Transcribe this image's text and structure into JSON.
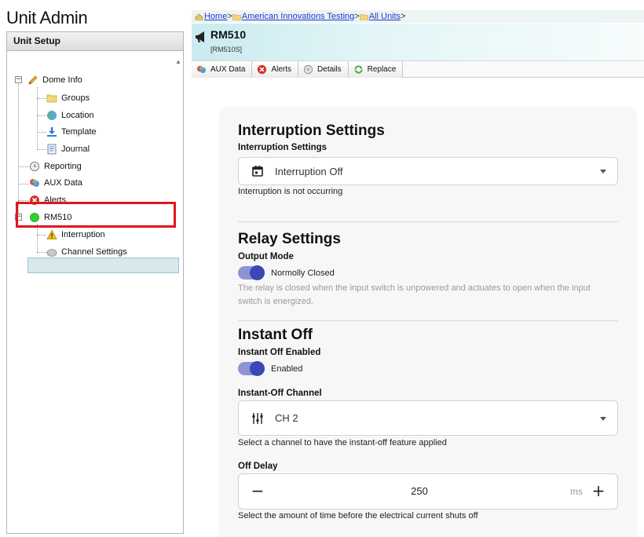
{
  "app": {
    "title": "Unit Admin"
  },
  "left_pane": {
    "header": "Unit Setup",
    "tree": {
      "dome_info": "Dome Info",
      "groups": "Groups",
      "location": "Location",
      "template": "Template",
      "journal": "Journal",
      "reporting": "Reporting",
      "aux_data": "AUX Data",
      "alerts": "Alerts",
      "rm510": "RM510",
      "interruption": "Interruption",
      "channel_settings": "Channel Settings"
    }
  },
  "breadcrumb": {
    "home": "Home",
    "american": "American Innovations Testing",
    "all_units": "All Units",
    "sep": ">"
  },
  "device": {
    "name": "RM510",
    "sub": "[RM510S]"
  },
  "tabs": {
    "aux_data": "AUX Data",
    "alerts": "Alerts",
    "details": "Details",
    "replace": "Replace"
  },
  "interruption_settings": {
    "title": "Interruption Settings",
    "label": "Interruption Settings",
    "value": "Interruption Off",
    "help": "Interruption is not occurring"
  },
  "relay_settings": {
    "title": "Relay Settings",
    "label": "Output Mode",
    "toggle_label": "Normolly Closed",
    "toggle_on": true,
    "help": "The relay is closed when the input switch is unpowered and actuates to open when the input switch is energized."
  },
  "instant_off": {
    "title": "Instant Off",
    "enabled_label": "Instant Off Enabled",
    "toggle_label": "Enabled",
    "toggle_on": true,
    "channel_label": "Instant-Off Channel",
    "channel_value": "CH 2",
    "channel_help": "Select a channel to have the instant-off feature applied",
    "delay_label": "Off Delay",
    "delay_value": "250",
    "delay_unit": "ms",
    "delay_help": "Select the amount of time before the electrical current shuts off",
    "minus": "−",
    "plus": "+"
  },
  "colors": {
    "accent": "#3a47b5",
    "highlight": "#e0161f",
    "selection": "#d8e9ee"
  }
}
